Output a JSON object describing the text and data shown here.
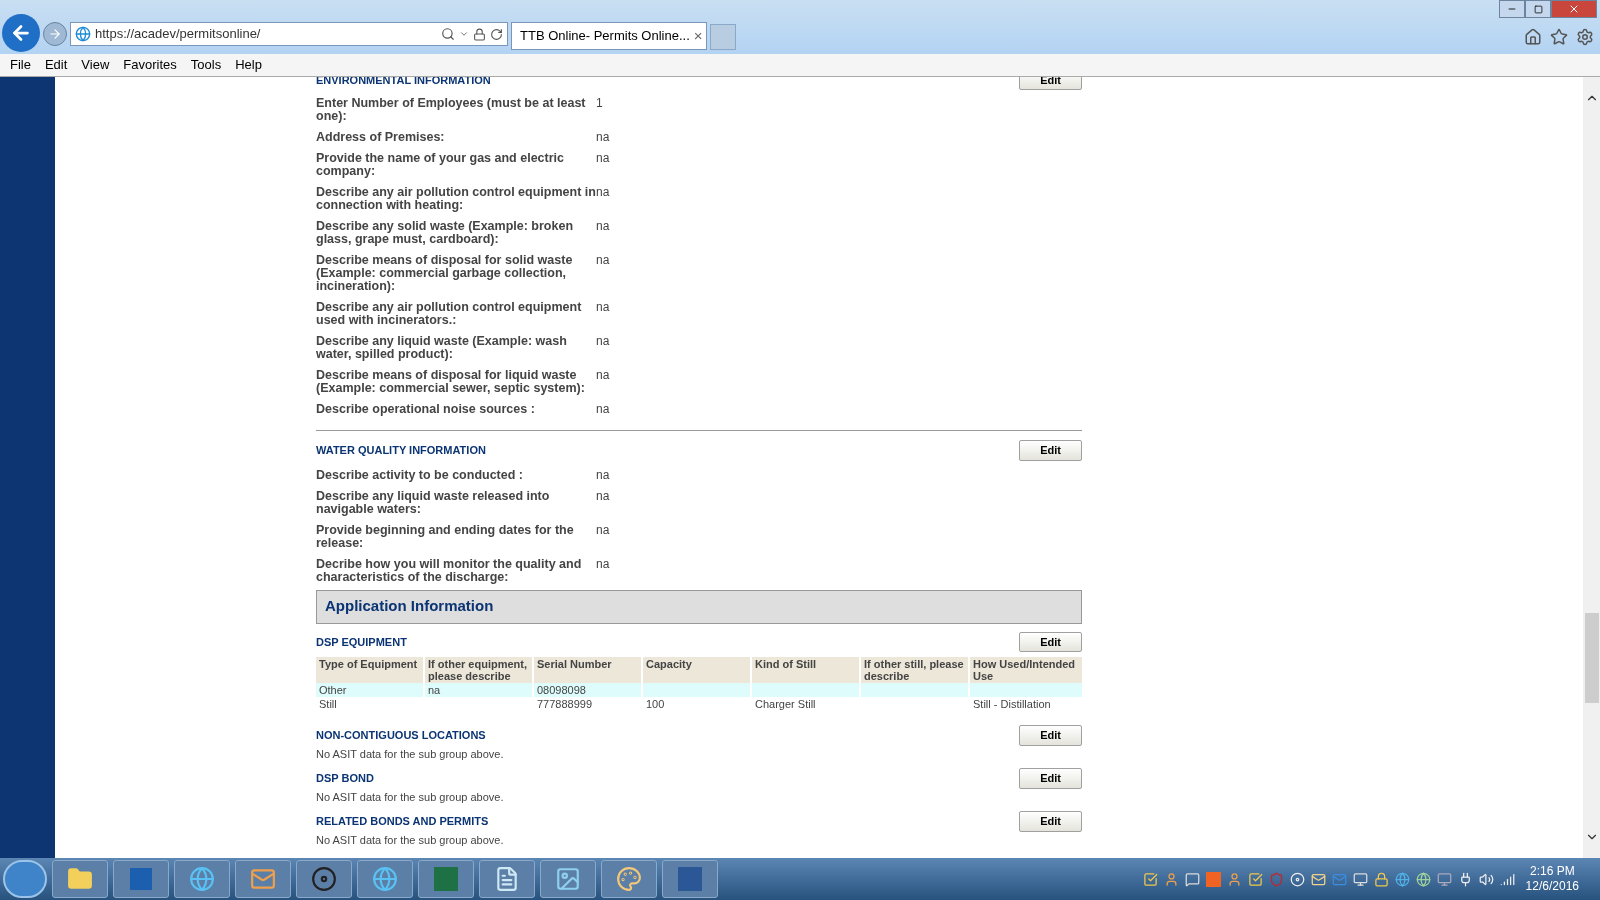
{
  "browser": {
    "address": "https://acadev/permitsonline/",
    "tabs": [
      {
        "title": "TTB Online- Permits Online...",
        "selected": true,
        "close": "×"
      }
    ],
    "menu": [
      "File",
      "Edit",
      "View",
      "Favorites",
      "Tools",
      "Help"
    ]
  },
  "environmental": {
    "heading": "ENVIRONMENTAL INFORMATION",
    "edit": "Edit",
    "fields": [
      {
        "label": "Enter Number of Employees (must be at least one):",
        "value": "1"
      },
      {
        "label": "Address of Premises:",
        "value": "na"
      },
      {
        "label": "Provide the name of your gas and electric company:",
        "value": "na"
      },
      {
        "label": "Describe any air pollution control equipment in connection with heating:",
        "value": "na"
      },
      {
        "label": "Describe any solid waste (Example: broken glass, grape must, cardboard):",
        "value": "na"
      },
      {
        "label": "Describe means of disposal for solid waste (Example: commercial garbage collection, incineration):",
        "value": "na"
      },
      {
        "label": "Describe any air pollution control equipment used with incinerators.:",
        "value": "na"
      },
      {
        "label": "Describe any liquid waste (Example: wash water, spilled product):",
        "value": "na"
      },
      {
        "label": "Describe means of disposal for liquid waste (Example: commercial sewer, septic system):",
        "value": "na"
      },
      {
        "label": "Describe operational noise sources :",
        "value": "na"
      }
    ]
  },
  "water_quality": {
    "heading": "WATER QUALITY INFORMATION",
    "edit": "Edit",
    "fields": [
      {
        "label": "Describe activity to be conducted :",
        "value": "na"
      },
      {
        "label": "Describe any liquid waste released into navigable waters:",
        "value": "na"
      },
      {
        "label": "Provide beginning and ending dates for the release:",
        "value": "na"
      },
      {
        "label": "Decribe how you will monitor the quality and characteristics of the discharge:",
        "value": "na"
      }
    ]
  },
  "application_info": {
    "title": "Application Information"
  },
  "dsp_equipment": {
    "heading": "DSP EQUIPMENT",
    "edit": "Edit",
    "table": {
      "columns": [
        "Type of Equipment",
        "If other equipment, please describe",
        "Serial Number",
        "Capacity",
        "Kind of Still",
        "If other still, please describe",
        "How Used/Intended Use"
      ],
      "rows": [
        {
          "shaded": true,
          "cells": [
            "Other",
            "na",
            "08098098",
            "",
            "",
            "",
            ""
          ]
        },
        {
          "shaded": false,
          "cells": [
            "Still",
            "",
            "777888999",
            "100",
            "Charger Still",
            "",
            "Still - Distillation"
          ]
        }
      ]
    }
  },
  "subgroups": [
    {
      "heading": "NON-CONTIGUOUS LOCATIONS",
      "edit": "Edit",
      "note": "No ASIT data for the sub group above."
    },
    {
      "heading": "DSP BOND",
      "edit": "Edit",
      "note": "No ASIT data for the sub group above."
    },
    {
      "heading": "RELATED BONDS AND PERMITS",
      "edit": "Edit",
      "note": "No ASIT data for the sub group above."
    }
  ],
  "taskbar": {
    "time": "2:16 PM",
    "date": "12/6/2016"
  }
}
